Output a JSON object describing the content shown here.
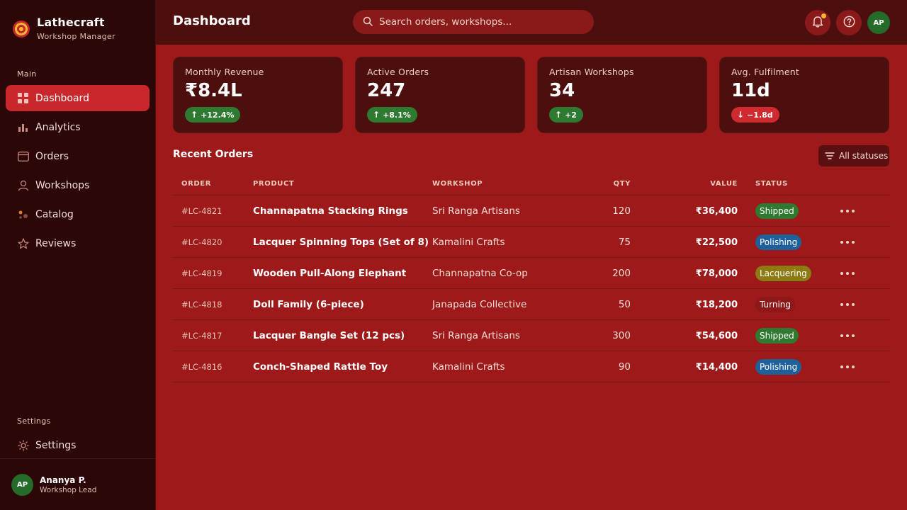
{
  "brand": {
    "name": "Lathecraft",
    "subtitle": "Workshop Manager"
  },
  "sidebar": {
    "main_label": "Main",
    "items": [
      {
        "label": "Dashboard",
        "icon": "grid-icon",
        "active": true
      },
      {
        "label": "Analytics",
        "icon": "bar-chart-icon",
        "active": false
      },
      {
        "label": "Orders",
        "icon": "card-icon",
        "active": false
      },
      {
        "label": "Workshops",
        "icon": "user-icon",
        "active": false
      },
      {
        "label": "Catalog",
        "icon": "shapes-icon",
        "active": false
      },
      {
        "label": "Reviews",
        "icon": "star-icon",
        "active": false
      }
    ],
    "settings_label": "Settings",
    "settings_item": {
      "label": "Settings",
      "icon": "sun-gear-icon"
    }
  },
  "user": {
    "initials": "AP",
    "name": "Ananya P.",
    "role": "Workshop Lead"
  },
  "header": {
    "title": "Dashboard",
    "search_placeholder": "Search orders, workshops...",
    "avatar_initials": "AP"
  },
  "stats": [
    {
      "label": "Monthly Revenue",
      "value": "₹8.4L",
      "change": "+12.4%",
      "direction": "up"
    },
    {
      "label": "Active Orders",
      "value": "247",
      "change": "+8.1%",
      "direction": "up"
    },
    {
      "label": "Artisan Workshops",
      "value": "34",
      "change": "+2",
      "direction": "up"
    },
    {
      "label": "Avg. Fulfilment",
      "value": "11d",
      "change": "−1.8d",
      "direction": "down"
    }
  ],
  "orders": {
    "title": "Recent Orders",
    "filter_label": "All statuses",
    "columns": {
      "order": "ORDER",
      "product": "PRODUCT",
      "workshop": "WORKSHOP",
      "qty": "QTY",
      "value": "VALUE",
      "status": "STATUS"
    },
    "rows": [
      {
        "order": "#LC-4821",
        "product": "Channapatna Stacking Rings",
        "workshop": "Sri Ranga Artisans",
        "qty": "120",
        "value": "₹36,400",
        "status": "Shipped"
      },
      {
        "order": "#LC-4820",
        "product": "Lacquer Spinning Tops (Set of 8)",
        "workshop": "Kamalini Crafts",
        "qty": "75",
        "value": "₹22,500",
        "status": "Polishing"
      },
      {
        "order": "#LC-4819",
        "product": "Wooden Pull-Along Elephant",
        "workshop": "Channapatna Co-op",
        "qty": "200",
        "value": "₹78,000",
        "status": "Lacquering"
      },
      {
        "order": "#LC-4818",
        "product": "Doll Family (6-piece)",
        "workshop": "Janapada Collective",
        "qty": "50",
        "value": "₹18,200",
        "status": "Turning"
      },
      {
        "order": "#LC-4817",
        "product": "Lacquer Bangle Set (12 pcs)",
        "workshop": "Sri Ranga Artisans",
        "qty": "300",
        "value": "₹54,600",
        "status": "Shipped"
      },
      {
        "order": "#LC-4816",
        "product": "Conch-Shaped Rattle Toy",
        "workshop": "Kamalini Crafts",
        "qty": "90",
        "value": "₹14,400",
        "status": "Polishing"
      }
    ]
  },
  "colors": {
    "background": "#9e1a1a",
    "sidebar": "#2b0707",
    "accent": "#c9272b",
    "positive": "#2d7a30",
    "negative": "#cf2a2f",
    "notification": "#f2b632"
  }
}
